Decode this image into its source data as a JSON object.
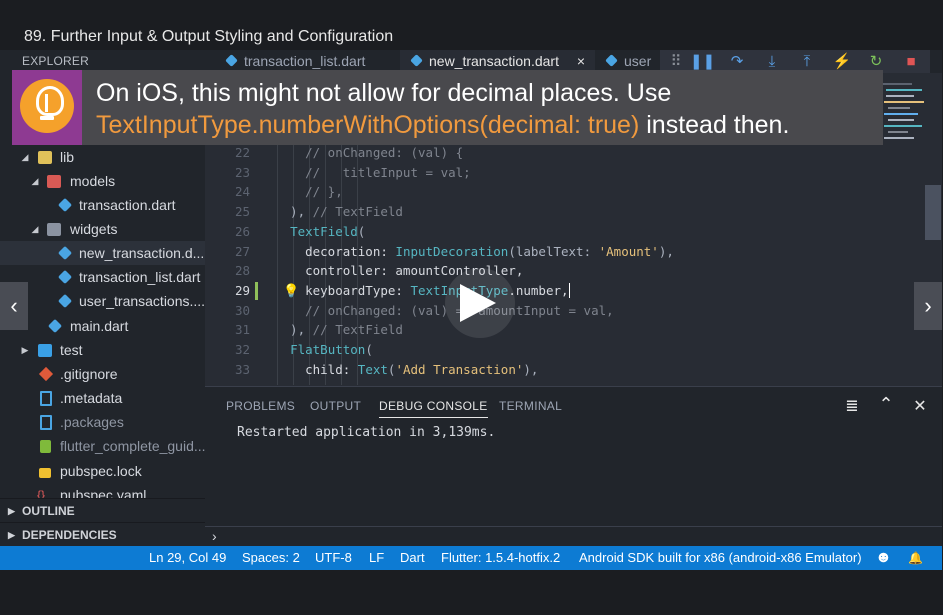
{
  "course": {
    "title": "89. Further Input & Output Styling and Configuration"
  },
  "explorer": {
    "title": "EXPLORER",
    "items": [
      {
        "label": "lib",
        "icon": "folder-icon"
      },
      {
        "label": "models",
        "icon": "folder-icon"
      },
      {
        "label": "transaction.dart",
        "icon": "dart-file-icon"
      },
      {
        "label": "widgets",
        "icon": "folder-icon"
      },
      {
        "label": "new_transaction.d...",
        "icon": "dart-file-icon",
        "selected": true
      },
      {
        "label": "transaction_list.dart",
        "icon": "dart-file-icon"
      },
      {
        "label": "user_transactions....",
        "icon": "dart-file-icon"
      },
      {
        "label": "main.dart",
        "icon": "dart-file-icon"
      },
      {
        "label": "test",
        "icon": "folder-icon"
      },
      {
        "label": ".gitignore",
        "icon": "git-icon"
      },
      {
        "label": ".metadata",
        "icon": "file-icon"
      },
      {
        "label": ".packages",
        "icon": "file-icon"
      },
      {
        "label": "flutter_complete_guid...",
        "icon": "flutter-icon"
      },
      {
        "label": "pubspec.lock",
        "icon": "lock-icon"
      },
      {
        "label": "pubspec.yaml",
        "icon": "yaml-icon"
      }
    ],
    "outline": "OUTLINE",
    "dependencies": "DEPENDENCIES"
  },
  "tabs": [
    {
      "label": "transaction_list.dart",
      "active": false
    },
    {
      "label": "new_transaction.dart",
      "active": true,
      "close": "×"
    },
    {
      "label": "user",
      "active": false
    }
  ],
  "debug_toolbar": {
    "icons": [
      "drag-handle-icon",
      "pause-icon",
      "step-over-icon",
      "step-into-icon",
      "step-out-icon",
      "hot-reload-icon",
      "restart-icon",
      "stop-icon"
    ],
    "glyphs": [
      "⠿",
      "❚❚",
      "↷",
      "⤓",
      "⤒",
      "⚡",
      "↻",
      "■"
    ],
    "colors": [
      "#8a8f98",
      "#5aa0e6",
      "#5aa0e6",
      "#5aa0e6",
      "#5aa0e6",
      "#f5b431",
      "#7cc15a",
      "#e05555"
    ]
  },
  "editor": {
    "lines": [
      {
        "num": "22",
        "parts": [
          {
            "t": "    // onChanged: (val) {",
            "c": "c-com"
          }
        ]
      },
      {
        "num": "23",
        "parts": [
          {
            "t": "    //   titleInput = val;",
            "c": "c-com"
          }
        ]
      },
      {
        "num": "24",
        "parts": [
          {
            "t": "    // },",
            "c": "c-com"
          }
        ]
      },
      {
        "num": "25",
        "parts": [
          {
            "t": "  ), ",
            "c": ""
          },
          {
            "t": "// TextField",
            "c": "c-com"
          }
        ]
      },
      {
        "num": "26",
        "parts": [
          {
            "t": "  ",
            "c": ""
          },
          {
            "t": "TextField",
            "c": "c-cls"
          },
          {
            "t": "(",
            "c": ""
          }
        ]
      },
      {
        "num": "27",
        "parts": [
          {
            "t": "    decoration: ",
            "c": "c-prop"
          },
          {
            "t": "InputDecoration",
            "c": "c-cls"
          },
          {
            "t": "(labelText: ",
            "c": ""
          },
          {
            "t": "'Amount'",
            "c": "c-str"
          },
          {
            "t": "),",
            "c": ""
          }
        ]
      },
      {
        "num": "28",
        "parts": [
          {
            "t": "    controller: amountController,",
            "c": "c-prop"
          }
        ]
      },
      {
        "num": "29",
        "parts": [
          {
            "t": "    keyboardType: ",
            "c": "c-prop"
          },
          {
            "t": "TextInputType",
            "c": "c-cls"
          },
          {
            "t": ".number,",
            "c": "c-prop"
          }
        ],
        "current": true
      },
      {
        "num": "30",
        "parts": [
          {
            "t": "    // onChanged: (val) => amountInput = val,",
            "c": "c-com"
          }
        ]
      },
      {
        "num": "31",
        "parts": [
          {
            "t": "  ), ",
            "c": ""
          },
          {
            "t": "// TextField",
            "c": "c-com"
          }
        ]
      },
      {
        "num": "32",
        "parts": [
          {
            "t": "  ",
            "c": ""
          },
          {
            "t": "FlatButton",
            "c": "c-cls"
          },
          {
            "t": "(",
            "c": ""
          }
        ]
      },
      {
        "num": "33",
        "parts": [
          {
            "t": "    child: ",
            "c": "c-prop"
          },
          {
            "t": "Text",
            "c": "c-cls"
          },
          {
            "t": "(",
            "c": ""
          },
          {
            "t": "'Add Transaction'",
            "c": "c-str"
          },
          {
            "t": "),",
            "c": ""
          }
        ]
      }
    ]
  },
  "banner": {
    "line1": "On iOS, this might not allow for decimal places. Use",
    "code": "TextInputType.numberWithOptions(decimal: true)",
    "line2_rest": " instead then."
  },
  "navigation": {
    "prev": "‹",
    "next": "›"
  },
  "panel": {
    "tabs": [
      "PROBLEMS",
      "OUTPUT",
      "DEBUG CONSOLE",
      "TERMINAL"
    ],
    "active_tab": "DEBUG CONSOLE",
    "console_output": "Restarted application in 3,139ms.",
    "prompt": "›",
    "icons": {
      "clear": "≣",
      "maximize": "⌃",
      "close": "✕"
    }
  },
  "statusbar": {
    "position": "Ln 29, Col 49",
    "spaces": "Spaces: 2",
    "encoding": "UTF-8",
    "eol": "LF",
    "language": "Dart",
    "flutter": "Flutter: 1.5.4-hotfix.2",
    "device": "Android SDK built for x86 (android-x86 Emulator)",
    "feedback": "☻",
    "bell": "🔔"
  },
  "colors": {
    "accent": "#0d7bd3",
    "banner_code": "#f19a3e",
    "banner_icon_bg": "#8e3a92"
  }
}
